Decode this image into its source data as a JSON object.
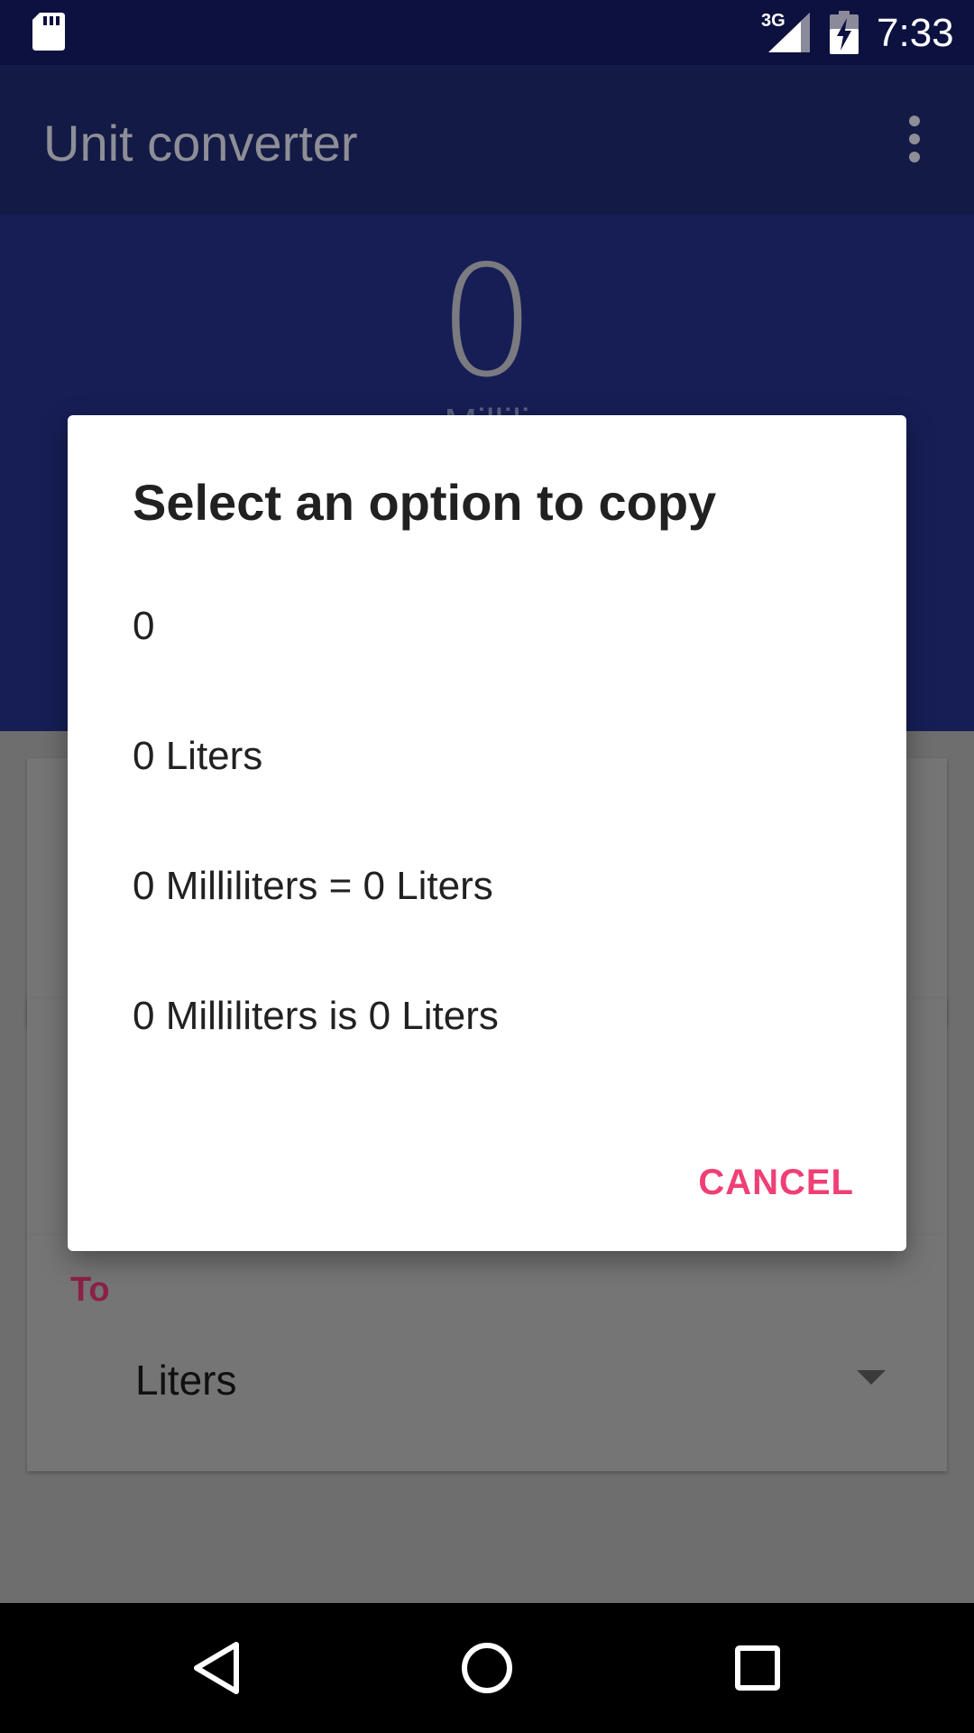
{
  "status_bar": {
    "network": "3G",
    "time": "7:33",
    "icons": [
      "sd-card-icon",
      "signal-icon",
      "battery-charging-icon"
    ]
  },
  "app_bar": {
    "title": "Unit converter",
    "menu_icon": "overflow-menu-icon"
  },
  "hero": {
    "value": "0",
    "unit_partial": "Millili"
  },
  "converter": {
    "to_label": "To",
    "to_value": "Liters"
  },
  "dialog": {
    "title": "Select an option to copy",
    "options": [
      "0",
      "0 Liters",
      "0 Milliliters = 0 Liters",
      "0 Milliliters is 0 Liters"
    ],
    "cancel_label": "CANCEL"
  },
  "nav_bar": {
    "icons": [
      "back-icon",
      "home-icon",
      "recent-apps-icon"
    ]
  },
  "colors": {
    "status_bar": "#0d1140",
    "app_bar": "#131a45",
    "accent": "#ef3f75",
    "scrim_bg": "#6e6e6e"
  }
}
